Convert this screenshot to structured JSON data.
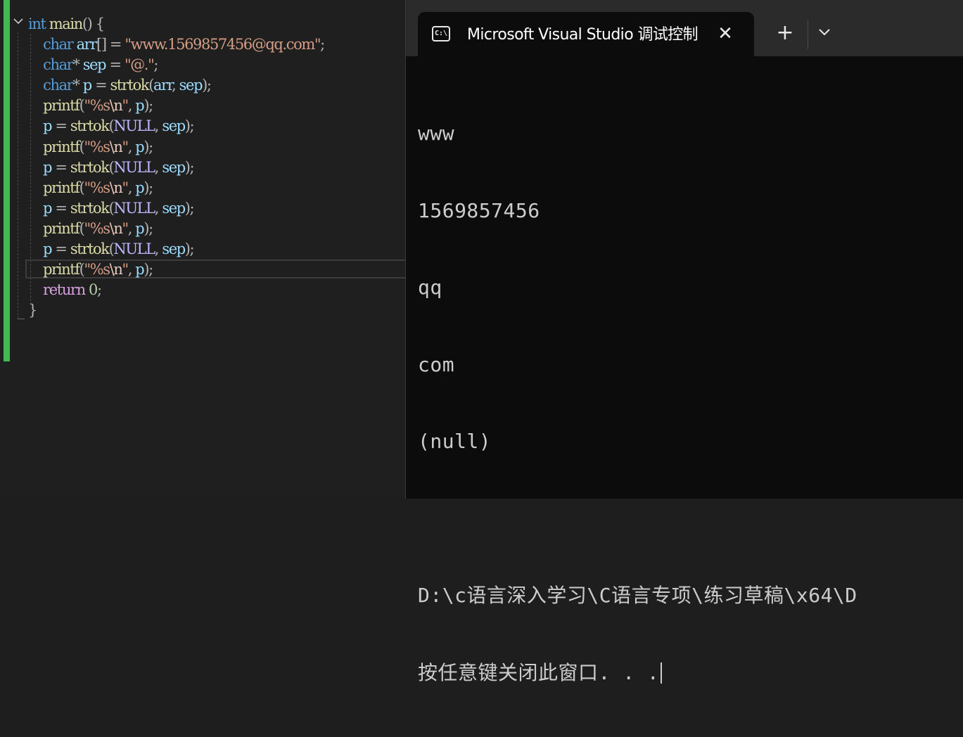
{
  "editor": {
    "lines": [
      [
        {
          "t": "int",
          "c": "kw"
        },
        {
          "t": " ",
          "c": ""
        },
        {
          "t": "main",
          "c": "fn"
        },
        {
          "t": "() {",
          "c": "punc"
        }
      ],
      [
        {
          "t": "    ",
          "c": ""
        },
        {
          "t": "char",
          "c": "kw"
        },
        {
          "t": " ",
          "c": ""
        },
        {
          "t": "arr",
          "c": "var"
        },
        {
          "t": "[] = ",
          "c": "punc"
        },
        {
          "t": "\"www.1569857456@qq.com\"",
          "c": "str"
        },
        {
          "t": ";",
          "c": "punc"
        }
      ],
      [
        {
          "t": "    ",
          "c": ""
        },
        {
          "t": "char",
          "c": "kw"
        },
        {
          "t": "* ",
          "c": "punc"
        },
        {
          "t": "sep",
          "c": "var"
        },
        {
          "t": " = ",
          "c": "punc"
        },
        {
          "t": "\"@.\"",
          "c": "str"
        },
        {
          "t": ";",
          "c": "punc"
        }
      ],
      [
        {
          "t": "    ",
          "c": ""
        },
        {
          "t": "char",
          "c": "kw"
        },
        {
          "t": "* ",
          "c": "punc"
        },
        {
          "t": "p",
          "c": "var"
        },
        {
          "t": " = ",
          "c": "punc"
        },
        {
          "t": "strtok",
          "c": "fn"
        },
        {
          "t": "(",
          "c": "punc"
        },
        {
          "t": "arr",
          "c": "var"
        },
        {
          "t": ", ",
          "c": "punc"
        },
        {
          "t": "sep",
          "c": "var"
        },
        {
          "t": ");",
          "c": "punc"
        }
      ],
      [
        {
          "t": "    ",
          "c": ""
        },
        {
          "t": "printf",
          "c": "fn"
        },
        {
          "t": "(",
          "c": "punc"
        },
        {
          "t": "\"%s",
          "c": "str"
        },
        {
          "t": "\\n",
          "c": "esc"
        },
        {
          "t": "\"",
          "c": "str"
        },
        {
          "t": ", ",
          "c": "punc"
        },
        {
          "t": "p",
          "c": "var"
        },
        {
          "t": ");",
          "c": "punc"
        }
      ],
      [
        {
          "t": "    ",
          "c": ""
        },
        {
          "t": "p",
          "c": "var"
        },
        {
          "t": " = ",
          "c": "punc"
        },
        {
          "t": "strtok",
          "c": "fn"
        },
        {
          "t": "(",
          "c": "punc"
        },
        {
          "t": "NULL",
          "c": "mac"
        },
        {
          "t": ", ",
          "c": "punc"
        },
        {
          "t": "sep",
          "c": "var"
        },
        {
          "t": ");",
          "c": "punc"
        }
      ],
      [
        {
          "t": "    ",
          "c": ""
        },
        {
          "t": "printf",
          "c": "fn"
        },
        {
          "t": "(",
          "c": "punc"
        },
        {
          "t": "\"%s",
          "c": "str"
        },
        {
          "t": "\\n",
          "c": "esc"
        },
        {
          "t": "\"",
          "c": "str"
        },
        {
          "t": ", ",
          "c": "punc"
        },
        {
          "t": "p",
          "c": "var"
        },
        {
          "t": ");",
          "c": "punc"
        }
      ],
      [
        {
          "t": "    ",
          "c": ""
        },
        {
          "t": "p",
          "c": "var"
        },
        {
          "t": " = ",
          "c": "punc"
        },
        {
          "t": "strtok",
          "c": "fn"
        },
        {
          "t": "(",
          "c": "punc"
        },
        {
          "t": "NULL",
          "c": "mac"
        },
        {
          "t": ", ",
          "c": "punc"
        },
        {
          "t": "sep",
          "c": "var"
        },
        {
          "t": ");",
          "c": "punc"
        }
      ],
      [
        {
          "t": "    ",
          "c": ""
        },
        {
          "t": "printf",
          "c": "fn"
        },
        {
          "t": "(",
          "c": "punc"
        },
        {
          "t": "\"%s",
          "c": "str"
        },
        {
          "t": "\\n",
          "c": "esc"
        },
        {
          "t": "\"",
          "c": "str"
        },
        {
          "t": ", ",
          "c": "punc"
        },
        {
          "t": "p",
          "c": "var"
        },
        {
          "t": ");",
          "c": "punc"
        }
      ],
      [
        {
          "t": "    ",
          "c": ""
        },
        {
          "t": "p",
          "c": "var"
        },
        {
          "t": " = ",
          "c": "punc"
        },
        {
          "t": "strtok",
          "c": "fn"
        },
        {
          "t": "(",
          "c": "punc"
        },
        {
          "t": "NULL",
          "c": "mac"
        },
        {
          "t": ", ",
          "c": "punc"
        },
        {
          "t": "sep",
          "c": "var"
        },
        {
          "t": ");",
          "c": "punc"
        }
      ],
      [
        {
          "t": "    ",
          "c": ""
        },
        {
          "t": "printf",
          "c": "fn"
        },
        {
          "t": "(",
          "c": "punc"
        },
        {
          "t": "\"%s",
          "c": "str"
        },
        {
          "t": "\\n",
          "c": "esc"
        },
        {
          "t": "\"",
          "c": "str"
        },
        {
          "t": ", ",
          "c": "punc"
        },
        {
          "t": "p",
          "c": "var"
        },
        {
          "t": ");",
          "c": "punc"
        }
      ],
      [
        {
          "t": "    ",
          "c": ""
        },
        {
          "t": "p",
          "c": "var"
        },
        {
          "t": " = ",
          "c": "punc"
        },
        {
          "t": "strtok",
          "c": "fn"
        },
        {
          "t": "(",
          "c": "punc"
        },
        {
          "t": "NULL",
          "c": "mac"
        },
        {
          "t": ", ",
          "c": "punc"
        },
        {
          "t": "sep",
          "c": "var"
        },
        {
          "t": ");",
          "c": "punc"
        }
      ],
      [
        {
          "t": "    ",
          "c": ""
        },
        {
          "t": "printf",
          "c": "fn"
        },
        {
          "t": "(",
          "c": "punc"
        },
        {
          "t": "\"%s",
          "c": "str"
        },
        {
          "t": "\\n",
          "c": "esc"
        },
        {
          "t": "\"",
          "c": "str"
        },
        {
          "t": ", ",
          "c": "punc"
        },
        {
          "t": "p",
          "c": "var"
        },
        {
          "t": ");",
          "c": "punc"
        }
      ],
      [
        {
          "t": "    ",
          "c": ""
        },
        {
          "t": "return",
          "c": "kw2"
        },
        {
          "t": " ",
          "c": ""
        },
        {
          "t": "0",
          "c": "num"
        },
        {
          "t": ";",
          "c": "punc"
        }
      ],
      [
        {
          "t": "}",
          "c": "punc"
        }
      ]
    ],
    "fold_icon": "chevron-down-icon",
    "change_bar_color": "#3fb950"
  },
  "terminal": {
    "tab_title": "Microsoft Visual Studio 调试控制台",
    "tab_icon": "console-icon",
    "tab_icon_glyph": "C:\\",
    "close_glyph": "✕",
    "new_tab_glyph": "+",
    "dropdown_icon": "chevron-down-icon",
    "output": [
      "www",
      "1569857456",
      "qq",
      "com",
      "(null)",
      "",
      "D:\\c语言深入学习\\C语言专项\\练习草稿\\x64\\D",
      "按任意键关闭此窗口. . ."
    ]
  }
}
